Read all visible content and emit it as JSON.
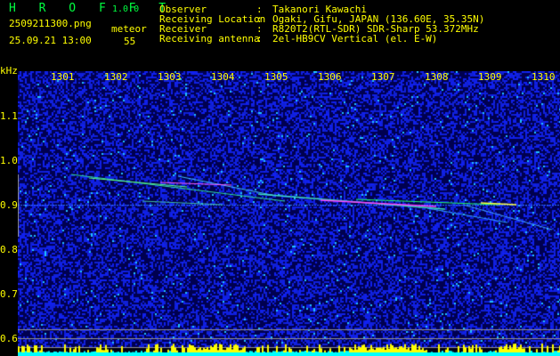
{
  "header": {
    "app": "H R O F F T",
    "version": "1.0.0",
    "filename": "2509211300.png",
    "datetime": "25.09.21 13:00",
    "meteor_label": "meteor",
    "meteor_count": "55"
  },
  "info": [
    {
      "label": "Observer",
      "sep": ":",
      "value": "Takanori Kawachi"
    },
    {
      "label": "Receiving Location",
      "sep": ":",
      "value": "Ogaki, Gifu, JAPAN (136.60E, 35.35N)"
    },
    {
      "label": "Receiver",
      "sep": ":",
      "value": "R820T2(RTL-SDR) SDR-Sharp 53.372MHz"
    },
    {
      "label": "Receiving antenna",
      "sep": ":",
      "value": "2el-HB9CV Vertical (el. E-W)"
    }
  ],
  "chart_data": {
    "type": "heatmap",
    "title": "HROFFT spectrogram",
    "ylabel": "kHz",
    "xticks": [
      "1301",
      "1302",
      "1303",
      "1304",
      "1305",
      "1306",
      "1307",
      "1308",
      "1309",
      "1310"
    ],
    "yticks": [
      "1.1",
      "1.0",
      "0.9",
      "0.8",
      "0.7",
      "0.6"
    ],
    "xlim": [
      1300,
      1310
    ],
    "ylim": [
      0.56,
      1.2
    ],
    "meteor_count": 55,
    "colors": {
      "background": "#000080",
      "noise": "#2030ff",
      "echo": "#00ff80",
      "strong": "#ff40ff",
      "bar_low": "#00ffff",
      "bar_high": "#ffff00"
    }
  }
}
